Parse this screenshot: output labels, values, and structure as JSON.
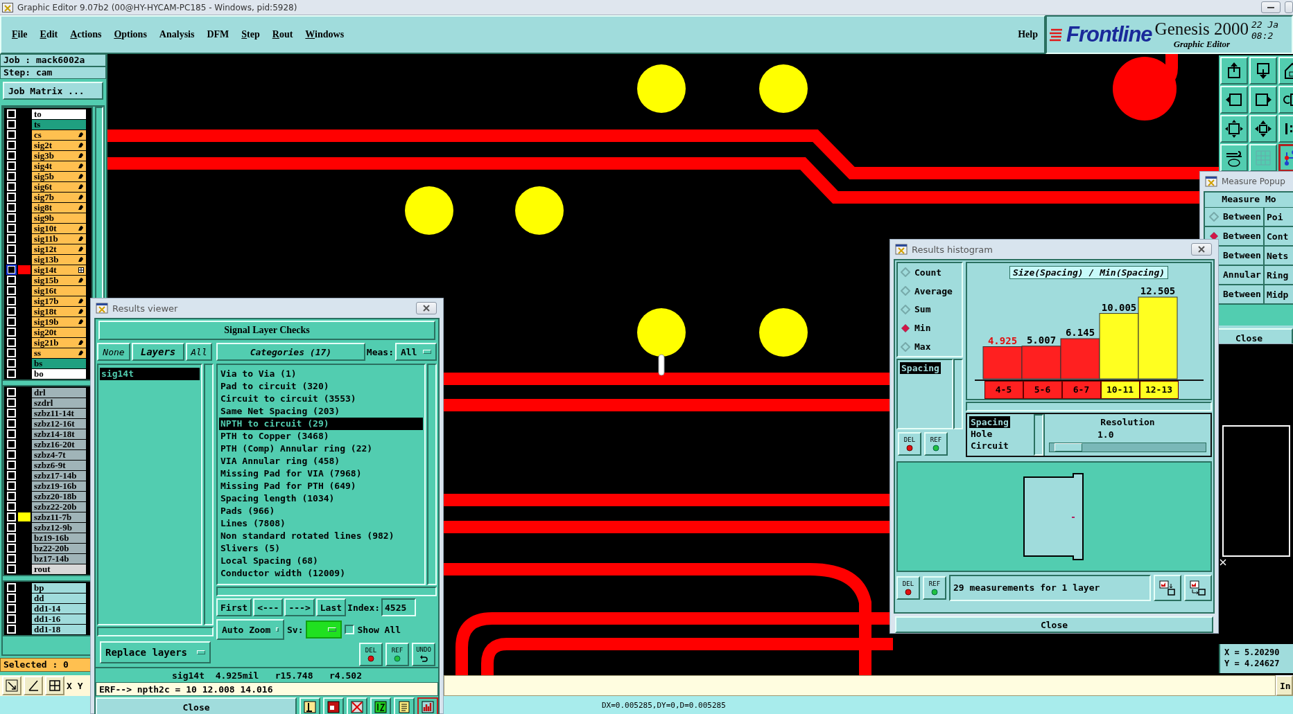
{
  "window": {
    "title": "Graphic Editor 9.07b2 (00@HY-HYCAM-PC185 - Windows, pid:5928)"
  },
  "menu": {
    "items": [
      {
        "label": "File",
        "mnemonic": true
      },
      {
        "label": "Edit",
        "mnemonic": true
      },
      {
        "label": "Actions",
        "mnemonic": true
      },
      {
        "label": "Options",
        "mnemonic": true
      },
      {
        "label": "Analysis",
        "mnemonic": false
      },
      {
        "label": "DFM",
        "mnemonic": false
      },
      {
        "label": "Step",
        "mnemonic": true
      },
      {
        "label": "Rout",
        "mnemonic": true
      },
      {
        "label": "Windows",
        "mnemonic": true
      }
    ],
    "help": "Help"
  },
  "logo": {
    "brand": "Frontline",
    "product": "Genesis 2000",
    "subtitle": "Graphic Editor",
    "date": "22 Ja",
    "time": "08:2"
  },
  "job_panel": {
    "job": "Job : mack6002a",
    "step": "Step: cam",
    "matrix_button": "Job Matrix ...",
    "layer_groups": [
      {
        "layers": [
          {
            "name": "to",
            "kind": "board",
            "affected": false,
            "selected": false
          },
          {
            "name": "ts",
            "kind": "mask",
            "affected": false,
            "selected": false
          },
          {
            "name": "cs",
            "kind": "signal",
            "affected": true,
            "selected": false
          },
          {
            "name": "sig2t",
            "kind": "signal",
            "affected": true,
            "selected": false
          },
          {
            "name": "sig3b",
            "kind": "signal",
            "affected": true,
            "selected": false
          },
          {
            "name": "sig4t",
            "kind": "signal",
            "affected": true,
            "selected": false
          },
          {
            "name": "sig5b",
            "kind": "signal",
            "affected": true,
            "selected": false
          },
          {
            "name": "sig6t",
            "kind": "signal",
            "affected": true,
            "selected": false
          },
          {
            "name": "sig7b",
            "kind": "signal",
            "affected": true,
            "selected": false
          },
          {
            "name": "sig8t",
            "kind": "signal",
            "affected": true,
            "selected": false
          },
          {
            "name": "sig9b",
            "kind": "signal",
            "affected": false,
            "selected": false
          },
          {
            "name": "sig10t",
            "kind": "signal",
            "affected": true,
            "selected": false
          },
          {
            "name": "sig11b",
            "kind": "signal",
            "affected": true,
            "selected": false
          },
          {
            "name": "sig12t",
            "kind": "signal",
            "affected": true,
            "selected": false
          },
          {
            "name": "sig13b",
            "kind": "signal",
            "affected": true,
            "selected": false
          },
          {
            "name": "sig14t",
            "kind": "signal",
            "affected": false,
            "selected": true,
            "color": "#ff0000"
          },
          {
            "name": "sig15b",
            "kind": "signal",
            "affected": true,
            "selected": false
          },
          {
            "name": "sig16t",
            "kind": "signal",
            "affected": false,
            "selected": false
          },
          {
            "name": "sig17b",
            "kind": "signal",
            "affected": true,
            "selected": false
          },
          {
            "name": "sig18t",
            "kind": "signal",
            "affected": true,
            "selected": false
          },
          {
            "name": "sig19b",
            "kind": "signal",
            "affected": true,
            "selected": false
          },
          {
            "name": "sig20t",
            "kind": "signal",
            "affected": false,
            "selected": false
          },
          {
            "name": "sig21b",
            "kind": "signal",
            "affected": true,
            "selected": false
          },
          {
            "name": "ss",
            "kind": "signal",
            "affected": true,
            "selected": false
          },
          {
            "name": "bs",
            "kind": "mask",
            "affected": false,
            "selected": false
          },
          {
            "name": "bo",
            "kind": "board",
            "affected": false,
            "selected": false
          }
        ]
      },
      {
        "layers": [
          {
            "name": "drl",
            "kind": "drill",
            "affected": false,
            "selected": false
          },
          {
            "name": "szdrl",
            "kind": "drill",
            "affected": false,
            "selected": false
          },
          {
            "name": "szbz11-14t",
            "kind": "drill",
            "affected": false,
            "selected": false
          },
          {
            "name": "szbz12-16t",
            "kind": "drill",
            "affected": false,
            "selected": false
          },
          {
            "name": "szbz14-18t",
            "kind": "drill",
            "affected": false,
            "selected": false
          },
          {
            "name": "szbz16-20t",
            "kind": "drill",
            "affected": false,
            "selected": false
          },
          {
            "name": "szbz4-7t",
            "kind": "drill",
            "affected": false,
            "selected": false
          },
          {
            "name": "szbz6-9t",
            "kind": "drill",
            "affected": false,
            "selected": false
          },
          {
            "name": "szbz17-14b",
            "kind": "drill",
            "affected": false,
            "selected": false
          },
          {
            "name": "szbz19-16b",
            "kind": "drill",
            "affected": false,
            "selected": false
          },
          {
            "name": "szbz20-18b",
            "kind": "drill",
            "affected": false,
            "selected": false
          },
          {
            "name": "szbz22-20b",
            "kind": "drill",
            "affected": false,
            "selected": false
          },
          {
            "name": "szbz11-7b",
            "kind": "drill",
            "affected": false,
            "selected": false,
            "color": "#ffff00"
          },
          {
            "name": "szbz12-9b",
            "kind": "drill",
            "affected": false,
            "selected": false
          },
          {
            "name": "bz19-16b",
            "kind": "drill",
            "affected": false,
            "selected": false
          },
          {
            "name": "bz22-20b",
            "kind": "drill",
            "affected": false,
            "selected": false
          },
          {
            "name": "bz17-14b",
            "kind": "drill",
            "affected": false,
            "selected": false
          },
          {
            "name": "rout",
            "kind": "rout",
            "affected": false,
            "selected": false
          }
        ]
      },
      {
        "layers": [
          {
            "name": "bp",
            "kind": "doc",
            "affected": false,
            "selected": false
          },
          {
            "name": "dd",
            "kind": "doc",
            "affected": false,
            "selected": false
          },
          {
            "name": "dd1-14",
            "kind": "doc",
            "affected": false,
            "selected": false
          },
          {
            "name": "dd1-16",
            "kind": "doc",
            "affected": false,
            "selected": false
          },
          {
            "name": "dd1-18",
            "kind": "doc",
            "affected": false,
            "selected": false
          }
        ]
      }
    ],
    "selected_count": "Selected : 0",
    "coord_label": "X Y"
  },
  "tool_palette": [
    {
      "active": false
    },
    {
      "active": false
    },
    {
      "active": false
    },
    {
      "active": false
    },
    {
      "active": false
    },
    {
      "active": false
    },
    {
      "active": false
    },
    {
      "active": false
    },
    {
      "active": false
    },
    {
      "active": false
    },
    {
      "active": false
    },
    {
      "active": true
    }
  ],
  "results_viewer": {
    "title": "Results viewer",
    "header": "Signal Layer Checks",
    "layer_buttons": [
      "None",
      "Layers",
      "All"
    ],
    "layers": [
      {
        "name": "sig14t",
        "selected": true
      }
    ],
    "categories_button": "Categories (17)",
    "meas_label": "Meas:",
    "meas_value": "All",
    "categories": [
      {
        "label": "Via to Via (1)",
        "selected": false
      },
      {
        "label": "Pad to circuit (320)",
        "selected": false
      },
      {
        "label": "Circuit to circuit (3553)",
        "selected": false
      },
      {
        "label": "Same Net Spacing (203)",
        "selected": false
      },
      {
        "label": "NPTH to circuit (29)",
        "selected": true
      },
      {
        "label": "PTH to Copper (3468)",
        "selected": false
      },
      {
        "label": "PTH (Comp) Annular ring (22)",
        "selected": false
      },
      {
        "label": "VIA Annular ring (458)",
        "selected": false
      },
      {
        "label": "Missing Pad for VIA (7968)",
        "selected": false
      },
      {
        "label": "Missing Pad for PTH (649)",
        "selected": false
      },
      {
        "label": "Spacing length (1034)",
        "selected": false
      },
      {
        "label": "Pads (966)",
        "selected": false
      },
      {
        "label": "Lines (7808)",
        "selected": false
      },
      {
        "label": "Non standard rotated lines (982)",
        "selected": false
      },
      {
        "label": "Slivers (5)",
        "selected": false
      },
      {
        "label": "Local Spacing (68)",
        "selected": false
      },
      {
        "label": "Conductor width (12009)",
        "selected": false
      }
    ],
    "nav": [
      "First",
      "<---",
      "--->",
      "Last"
    ],
    "index_label": "Index:",
    "index_value": "4525",
    "zoom_mode": "Auto Zoom",
    "sv_label": "Sv:",
    "show_all": {
      "label": "Show All",
      "checked": false
    },
    "replace_button": "Replace layers",
    "tool_buttons": [
      {
        "label": "DEL",
        "kind": "delete"
      },
      {
        "label": "REF",
        "kind": "refresh"
      },
      {
        "label": "UNDO",
        "kind": "undo"
      }
    ],
    "info": "sig14t  4.925mil   r15.748   r4.502",
    "erf": "ERF--> npth2c = 10 12.008 14.016",
    "close": "Close",
    "icon_buttons": [
      {
        "kind": "flag",
        "active": false
      },
      {
        "kind": "report",
        "active": false
      },
      {
        "kind": "cross",
        "active": false
      },
      {
        "kind": "split",
        "active": false
      },
      {
        "kind": "notes",
        "active": false
      },
      {
        "kind": "histogram",
        "active": true
      }
    ]
  },
  "results_histogram": {
    "title": "Results histogram",
    "modes": [
      {
        "label": "Count",
        "selected": false
      },
      {
        "label": "Average",
        "selected": false
      },
      {
        "label": "Sum",
        "selected": false
      },
      {
        "label": "Min",
        "selected": true
      },
      {
        "label": "Max",
        "selected": false
      }
    ],
    "measures": [
      {
        "label": "Spacing",
        "selected": true
      }
    ],
    "tool_buttons": [
      {
        "label": "DEL",
        "kind": "delete"
      },
      {
        "label": "REF",
        "kind": "refresh"
      }
    ],
    "chart_data": {
      "type": "bar",
      "title": "Size(Spacing) / Min(Spacing)",
      "categories": [
        "4-5",
        "5-6",
        "6-7",
        "10-11",
        "12-13"
      ],
      "values": [
        4.925,
        5.007,
        6.145,
        10.005,
        12.505
      ],
      "data_labels": true
    },
    "bins": [
      {
        "color": "#ff2020",
        "highlighted": true
      },
      {
        "color": "#ff2020",
        "highlighted": false
      },
      {
        "color": "#ff2020",
        "highlighted": false
      },
      {
        "color": "#ffff20",
        "highlighted": false
      },
      {
        "color": "#ffff20",
        "highlighted": false
      }
    ],
    "attributes": [
      {
        "label": "Spacing",
        "selected": true
      },
      {
        "label": "Hole",
        "selected": false
      },
      {
        "label": "Circuit",
        "selected": false
      }
    ],
    "resolution": {
      "label": "Resolution",
      "value": "1.0",
      "level": 0.12
    },
    "bottom_buttons": [
      {
        "label": "DEL",
        "kind": "delete"
      },
      {
        "label": "REF",
        "kind": "refresh"
      }
    ],
    "summary": "29 measurements for 1 layer",
    "close": "Close"
  },
  "measure_popup": {
    "title": "Measure Popup",
    "header": "Measure Mo",
    "modes": [
      {
        "col1": "Between",
        "col2": "Poi",
        "selected": false
      },
      {
        "col1": "Between",
        "col2": "Cont",
        "selected": true
      },
      {
        "col1": "Between",
        "col2": "Nets"
      },
      {
        "col1": "Annular",
        "col2": "Ring"
      },
      {
        "col1": "Between",
        "col2": "Midp"
      }
    ],
    "close": "Close"
  },
  "coordinates": {
    "x": "X = 5.20290",
    "y": "Y = 4.24627"
  },
  "status": {
    "message": "DX=0.005285,DY=0,D=0.005285",
    "button": "In"
  }
}
